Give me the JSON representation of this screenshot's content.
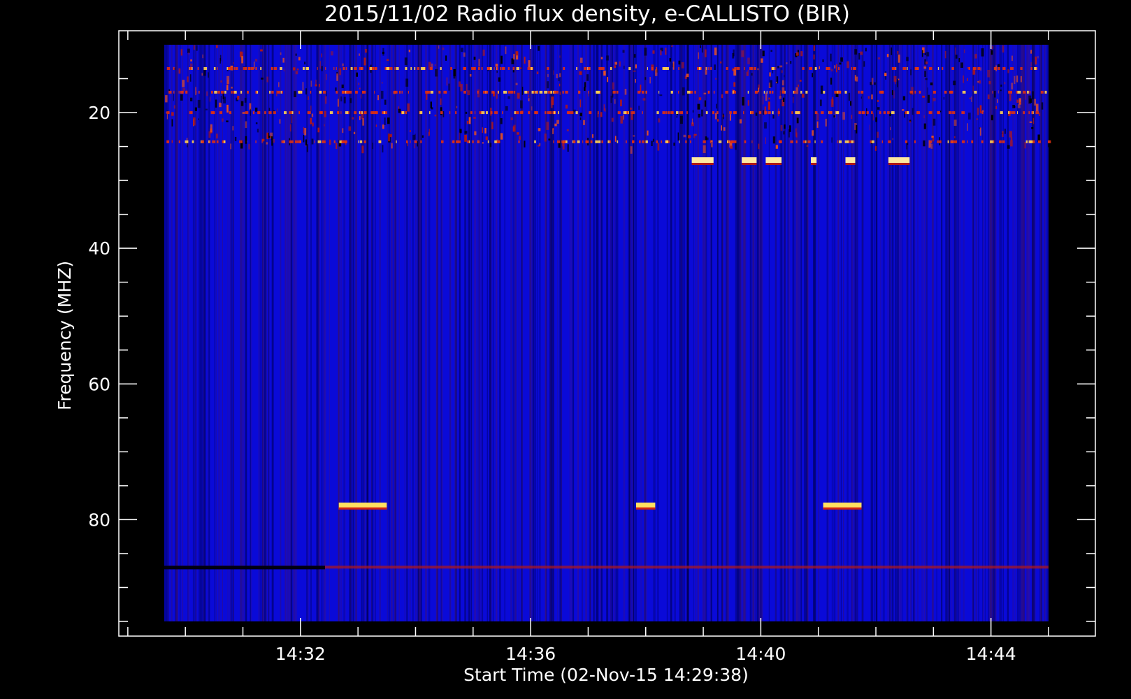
{
  "chart_data": {
    "type": "heatmap",
    "title": "2015/11/02  Radio flux density, e-CALLISTO (BIR)",
    "xlabel": "Start Time (02-Nov-15 14:29:38)",
    "ylabel": "Frequency (MHZ)",
    "x_range": [
      "14:29:38",
      "14:45:00"
    ],
    "y_range": [
      10,
      95
    ],
    "y_inverted": true,
    "grid": false,
    "colors": {
      "background": "#000000",
      "axes": "#ffffff",
      "data_low": "#0a0ad8",
      "data_mid": "#b01818",
      "data_high": "#ffe060"
    },
    "x_ticks": [
      "14:32",
      "14:36",
      "14:40",
      "14:44"
    ],
    "y_ticks": [
      20,
      40,
      60,
      80
    ],
    "features": [
      {
        "kind": "interference-band",
        "freq_range": [
          10,
          25
        ],
        "time_range": [
          "14:29:38",
          "14:45:00"
        ],
        "level": "high"
      },
      {
        "kind": "burst",
        "freq": 27,
        "time_range": [
          "14:38:48",
          "14:42:40"
        ],
        "level": "high"
      },
      {
        "kind": "burst",
        "freq": 78,
        "time_range": [
          "14:32:40",
          "14:33:30"
        ],
        "level": "high"
      },
      {
        "kind": "burst",
        "freq": 78,
        "time_range": [
          "14:37:50",
          "14:38:10"
        ],
        "level": "high"
      },
      {
        "kind": "burst",
        "freq": 78,
        "time_range": [
          "14:41:05",
          "14:41:45"
        ],
        "level": "high"
      },
      {
        "kind": "band",
        "freq": 87,
        "time_range": [
          "14:29:38",
          "14:45:00"
        ],
        "level": "mid"
      }
    ]
  }
}
